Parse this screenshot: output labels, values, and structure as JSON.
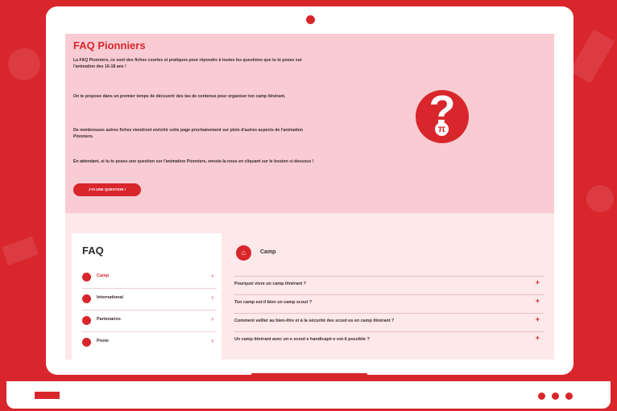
{
  "colors": {
    "brand": "#d8262c",
    "hero_bg": "#f8ccd2",
    "page_bg": "#fde8ea"
  },
  "hero": {
    "title": "FAQ Pionniers",
    "paragraphs": [
      "La FAQ Pionniers, ce sont des fiches courtes et pratiques pour répondre à toutes les questions que tu te poses sur l'animation des 16-18 ans !",
      "On te propose dans un premier temps de découvrir des tas de contenus pour organiser ton camp itinérant.",
      "De nombreuses autres fiches viendront enrichir cette page prochainement sur plein d'autres aspects de l'animation Pionniers.",
      "En attendant, si tu te poses une question sur l'animation Pionniers, envoie-la nous en cliquant sur le bouton ci-dessous !"
    ],
    "cta_label": "J'AI UNE QUESTION !",
    "illustration": {
      "icon": "question-mark-icon",
      "badge": "π"
    }
  },
  "faq": {
    "title": "FAQ",
    "categories": [
      {
        "label": "Camp",
        "icon": "tent-icon",
        "active": true
      },
      {
        "label": "International",
        "icon": "globe-icon",
        "active": false
      },
      {
        "label": "Partenaires",
        "icon": "handshake-icon",
        "active": false
      },
      {
        "label": "Poste",
        "icon": "post-icon",
        "active": false
      }
    ],
    "chevron": "›"
  },
  "section": {
    "title": "Camp",
    "icon": "tent-icon",
    "toggle": "+",
    "questions": [
      "Pourquoi vivre un camp itinérant ?",
      "Ton camp est-il bien un camp scout ?",
      "Comment veiller au bien-être et à la sécurité des scout·es en camp itinérant ?",
      "Un camp itinérant avec un·e scout·e handicapé·e est-il possible ?"
    ]
  },
  "icons": {
    "camp_glyph": "⌂",
    "tent_glyph": "⌂",
    "question_glyph": "?"
  }
}
